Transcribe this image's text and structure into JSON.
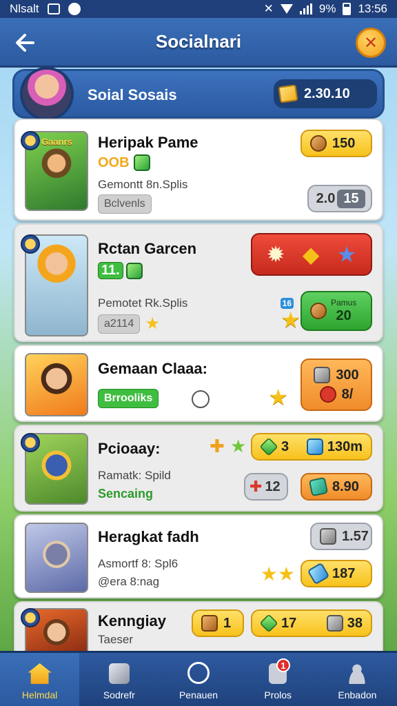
{
  "status_bar": {
    "carrier": "Nlsalt",
    "battery": "9%",
    "time": "13:56"
  },
  "header": {
    "title": "Socialnari",
    "back_icon": "arrow-left-icon",
    "close_icon": "close-icon"
  },
  "profile": {
    "name": "Soial Sosais",
    "coins": "2.30.10"
  },
  "games": [
    {
      "name": "Heripak Pame",
      "thumb_label": "Gaanrs",
      "badge": "OOB",
      "subtitle": "Gemontt 8n.Splis",
      "tag": "Bclvenls",
      "reward": "150",
      "stat_a": "2.0",
      "stat_b": "15"
    },
    {
      "name": "Rctan Garcen",
      "badge": "11.",
      "subtitle": "Pemotet Rk.Splis",
      "tag": "a2114",
      "side_badge": "16",
      "pill_top": "Pamus",
      "pill_value": "20"
    },
    {
      "name": "Gemaan Claaa:",
      "tag": "Brrooliks",
      "reward_top": "300",
      "reward_bottom": "8/"
    },
    {
      "name": "Pcioaay:",
      "subtitle": "Ramatk: Spild",
      "status": "Sencaing",
      "pill_a_left": "3",
      "pill_a_right": "130m",
      "pill_b": "12",
      "pill_c": "8.90"
    },
    {
      "name": "Heragkat fadh",
      "subtitle": "Asmortf 8: Spl6",
      "subtitle2": "@era 8:nag",
      "pill_top": "1.57",
      "pill_bottom": "187"
    },
    {
      "name": "Kenngiay",
      "subtitle": "Taeser",
      "pill_a": "1",
      "pill_b": "17",
      "pill_c": "38"
    }
  ],
  "nav": [
    {
      "label": "Helmdal",
      "icon": "home-icon"
    },
    {
      "label": "Sodrefr",
      "icon": "cube-icon"
    },
    {
      "label": "Penauen",
      "icon": "clock-icon"
    },
    {
      "label": "Prolos",
      "icon": "document-icon",
      "badge": "1"
    },
    {
      "label": "Enbadon",
      "icon": "person-icon"
    }
  ]
}
